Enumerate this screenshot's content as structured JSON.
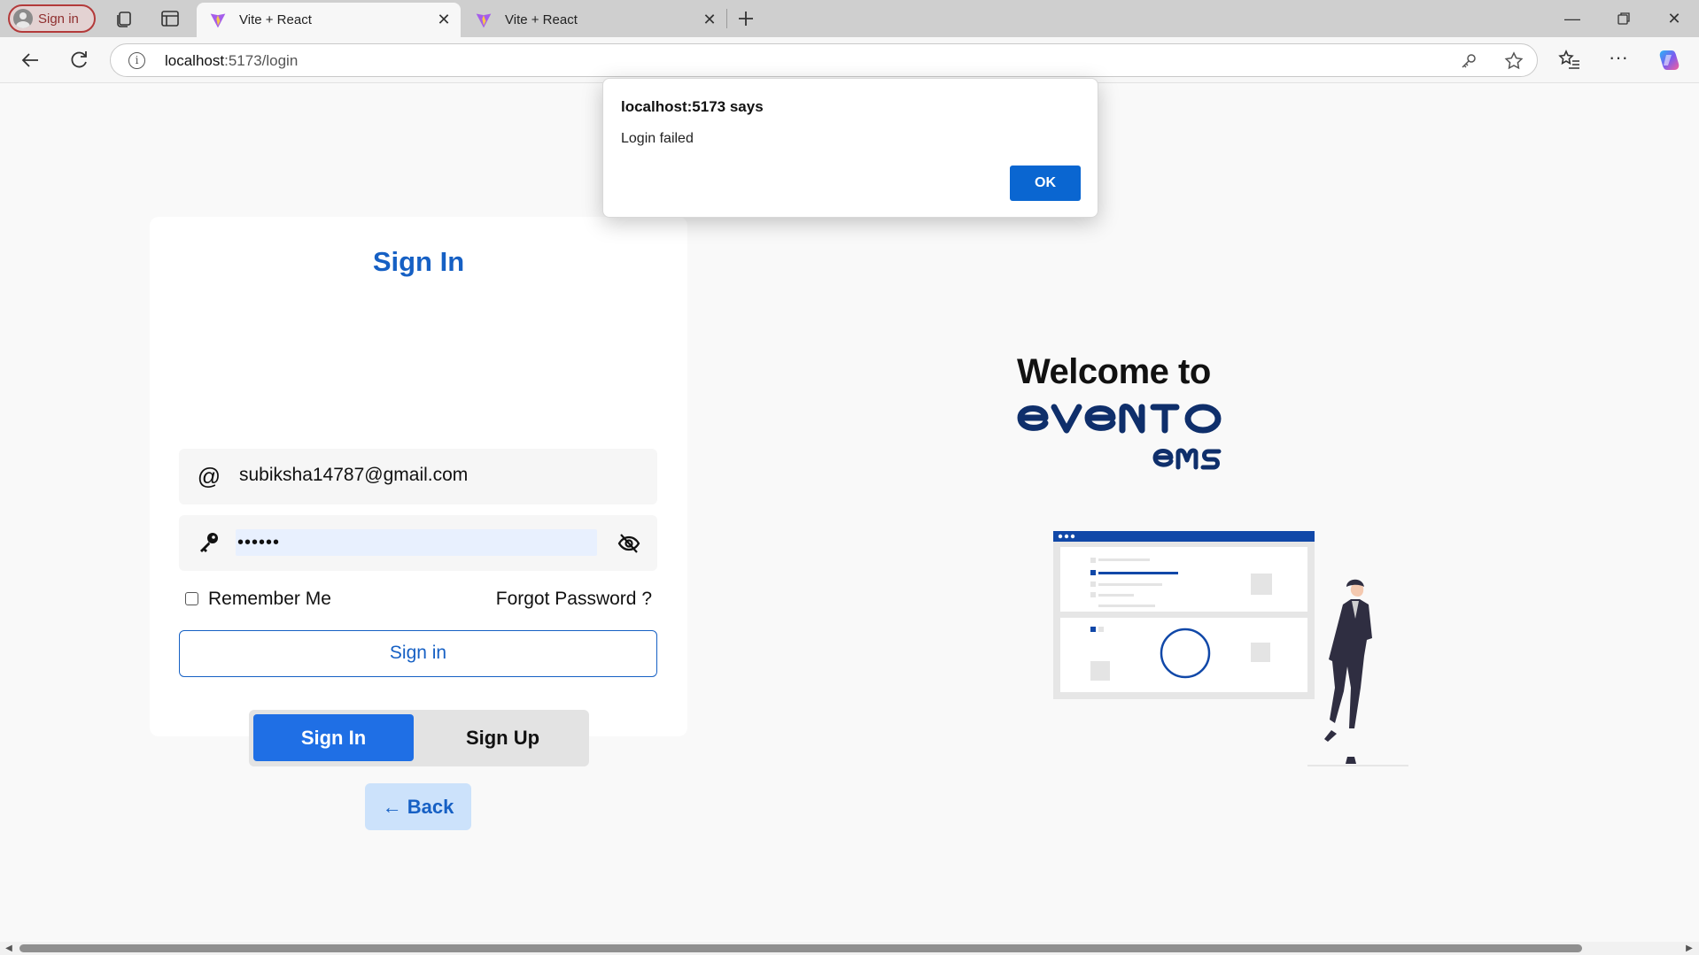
{
  "browser": {
    "profile_label": "Sign in",
    "tabs": [
      {
        "title": "Vite + React",
        "active": true
      },
      {
        "title": "Vite + React",
        "active": false
      }
    ],
    "url_host": "localhost",
    "url_rest": ":5173/login",
    "icons": {
      "profile": "person-icon",
      "collections": "collections-icon",
      "tab_actions": "tab-actions-icon",
      "new_tab": "plus-icon",
      "back": "back-arrow-icon",
      "refresh": "refresh-icon",
      "info": "info-icon",
      "password": "key-icon",
      "favorite": "star-icon",
      "favorites": "favorites-list-icon",
      "more": "more-icon",
      "copilot": "copilot-icon"
    }
  },
  "login": {
    "title": "Sign In",
    "email_value": "subiksha14787@gmail.com",
    "email_icon": "@",
    "password_value": "••••••",
    "remember_label": "Remember Me",
    "remember_checked": false,
    "forgot_label": "Forgot Password ?",
    "submit_label": "Sign in",
    "toggle_signin": "Sign In",
    "toggle_signup": "Sign Up",
    "back_label": "Back"
  },
  "hero": {
    "welcome": "Welcome to",
    "brand": "evento",
    "brand_sub": "ems"
  },
  "dialog": {
    "title": "localhost:5173 says",
    "message": "Login failed",
    "ok_label": "OK"
  },
  "colors": {
    "primary": "#1660c4",
    "toggle_active": "#1f6fe5",
    "brand_navy": "#0f2f6b",
    "dialog_ok": "#0a66d1",
    "back_bg": "#cce2fb"
  }
}
